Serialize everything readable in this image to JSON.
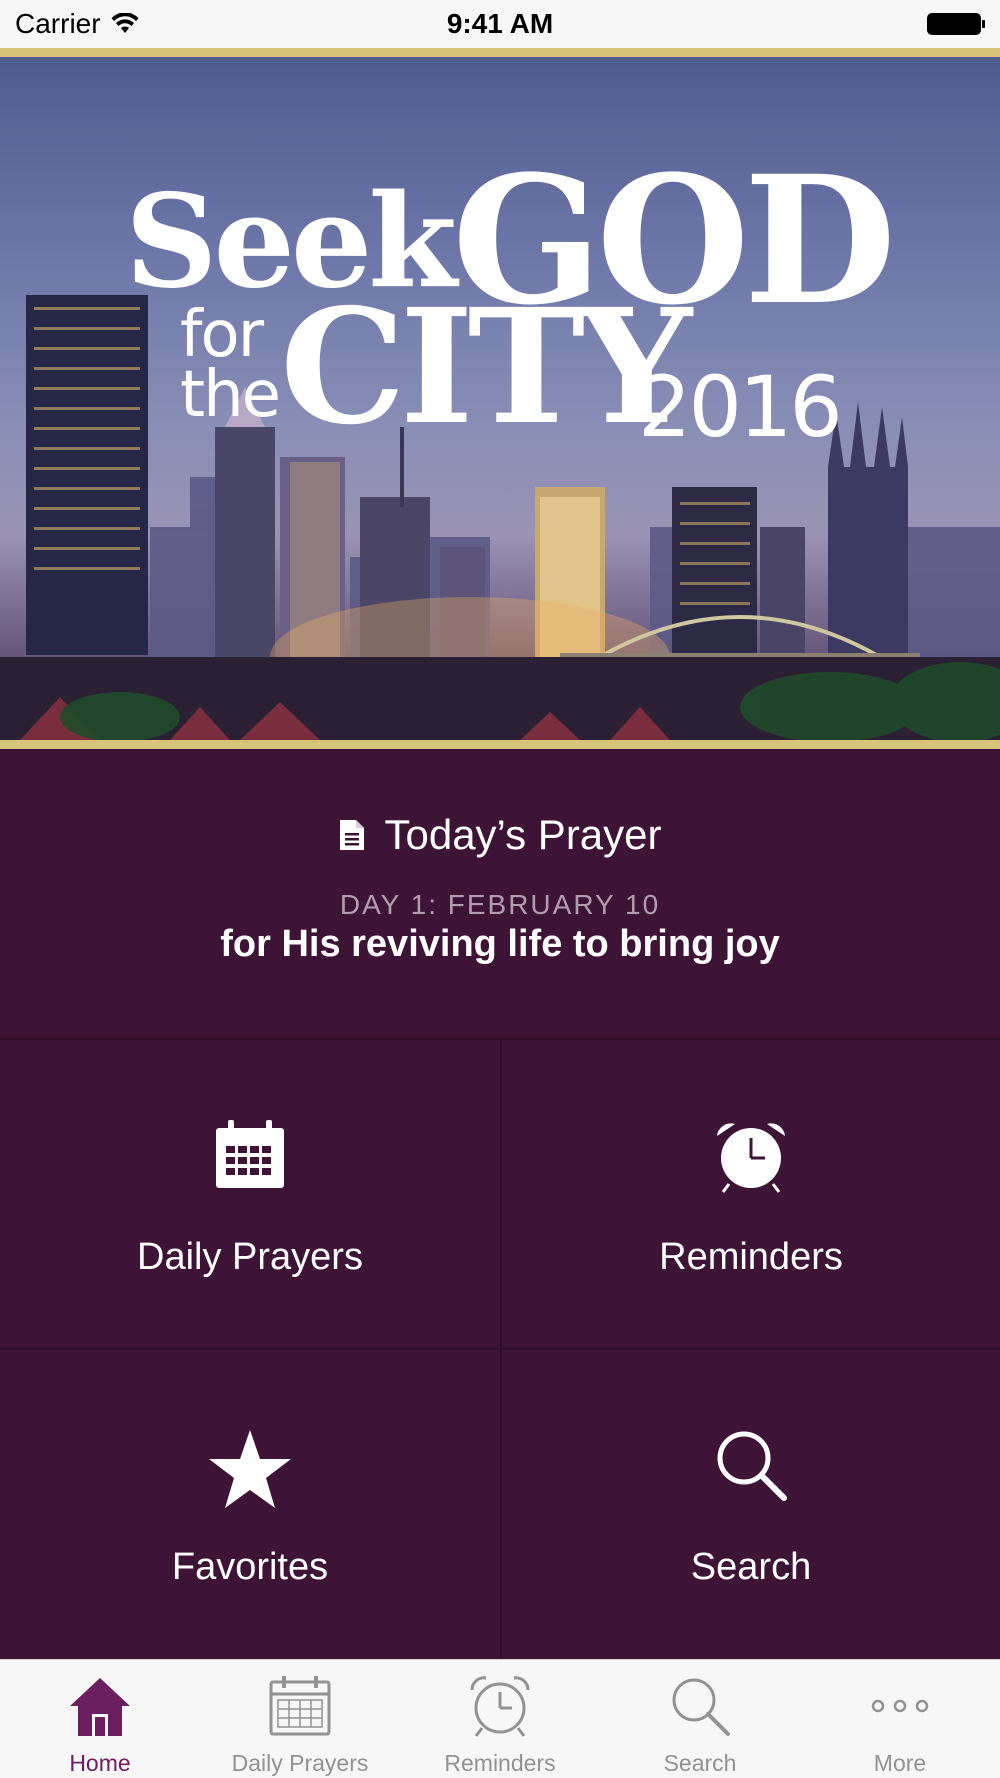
{
  "status_bar": {
    "carrier": "Carrier",
    "time": "9:41 AM"
  },
  "hero": {
    "seek": "Seek",
    "god": "GOD",
    "for": "for",
    "the": "the",
    "city": "CITY",
    "year": "2016"
  },
  "today": {
    "title": "Today’s Prayer",
    "day": "DAY 1: FEBRUARY 10",
    "text": "for His reviving life to bring joy"
  },
  "tiles": [
    {
      "label": "Daily Prayers",
      "icon": "calendar-icon"
    },
    {
      "label": "Reminders",
      "icon": "alarm-clock-icon"
    },
    {
      "label": "Favorites",
      "icon": "star-icon"
    },
    {
      "label": "Search",
      "icon": "search-icon"
    }
  ],
  "tabbar": {
    "items": [
      {
        "label": "Home",
        "icon": "home-icon",
        "active": true
      },
      {
        "label": "Daily Prayers",
        "icon": "calendar-icon"
      },
      {
        "label": "Reminders",
        "icon": "alarm-clock-icon"
      },
      {
        "label": "Search",
        "icon": "search-icon"
      },
      {
        "label": "More",
        "icon": "more-icon"
      }
    ]
  },
  "colors": {
    "background": "#3d1436",
    "gold": "#d8c37a",
    "accent": "#6b1f5f",
    "inactive": "#929292"
  }
}
